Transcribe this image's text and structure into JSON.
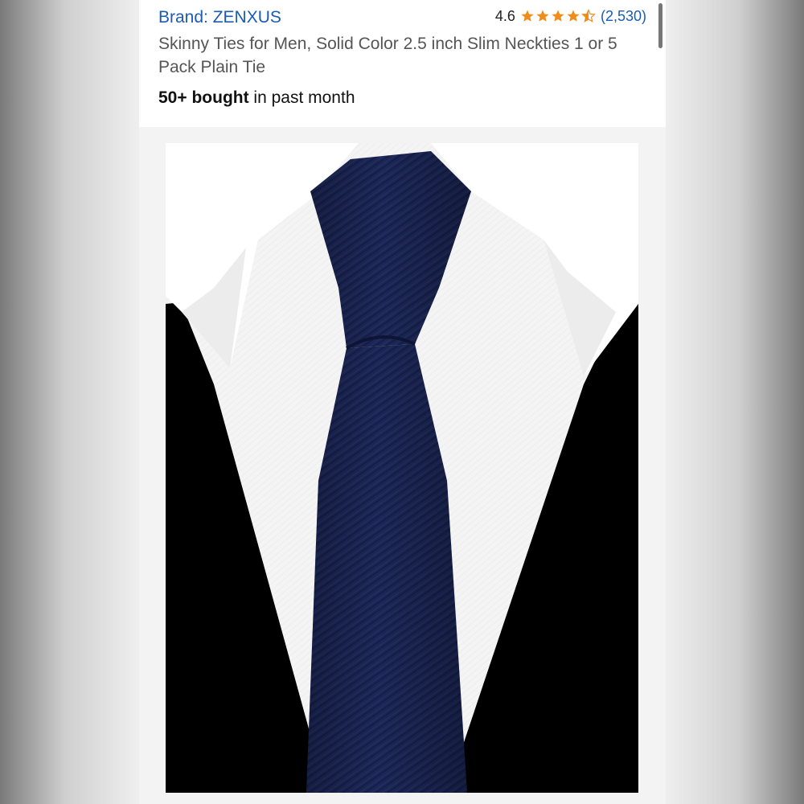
{
  "product": {
    "brand_label": "Brand: ZENXUS",
    "rating_value": "4.6",
    "rating_stars": 4.6,
    "rating_count": "(2,530)",
    "title": "Skinny Ties for Men, Solid Color 2.5 inch Slim Neckties 1 or 5 Pack Plain Tie",
    "bought_bold": "50+ bought",
    "bought_rest": " in past month"
  },
  "colors": {
    "link": "#1a5bb5",
    "star": "#f08c1a",
    "tie": "#1c2757"
  },
  "icons": {
    "star_full": "star-icon",
    "star_half": "star-half-icon"
  }
}
